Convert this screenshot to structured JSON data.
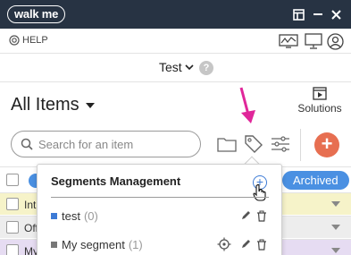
{
  "titlebar": {
    "logo": "walk me"
  },
  "helpbar": {
    "help_label": "HELP"
  },
  "env": {
    "label": "Test",
    "help_glyph": "?"
  },
  "section": {
    "title": "All Items",
    "solutions_label": "Solutions"
  },
  "search": {
    "placeholder": "Search for an item"
  },
  "toolbar": {
    "add_glyph": "+"
  },
  "filters": {
    "archived_label": "Archived"
  },
  "list": {
    "rows": [
      {
        "label": "Int",
        "color": "#f6f3c9"
      },
      {
        "label": "Off",
        "color": "#ededed"
      },
      {
        "label": "My",
        "color": "#e6dcf2"
      }
    ]
  },
  "segments_popup": {
    "title": "Segments Management",
    "items": [
      {
        "name": "test",
        "count": "(0)",
        "color": "#3d7bd6"
      },
      {
        "name": "My segment",
        "count": "(1)",
        "color": "#777777"
      }
    ]
  },
  "colors": {
    "titlebar": "#273343",
    "accent_blue": "#4a90e2",
    "add_button": "#e76f51",
    "annotation_arrow": "#e0279a"
  }
}
